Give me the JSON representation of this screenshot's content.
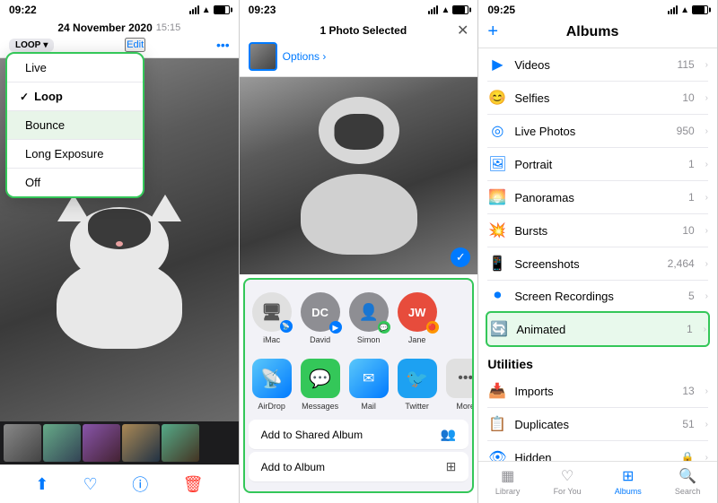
{
  "panel1": {
    "status_time": "09:22",
    "date": "24 November 2020",
    "date_sub": "15:15",
    "edit_label": "Edit",
    "loop_label": "LOOP",
    "dropdown": {
      "items": [
        {
          "label": "Live",
          "selected": false,
          "highlighted": false
        },
        {
          "label": "Loop",
          "selected": true,
          "highlighted": false
        },
        {
          "label": "Bounce",
          "selected": false,
          "highlighted": true
        },
        {
          "label": "Long Exposure",
          "selected": false,
          "highlighted": false
        },
        {
          "label": "Off",
          "selected": false,
          "highlighted": false
        }
      ]
    },
    "toolbar": {
      "share": "↑",
      "heart": "♡",
      "info": "ⓘ",
      "trash": "🗑"
    }
  },
  "panel2": {
    "status_time": "09:23",
    "photo_count": "1 Photo Selected",
    "options_label": "Options ›",
    "close_label": "✕",
    "share_contacts": [
      {
        "name": "iMac",
        "initials": "🖥",
        "badge": "📡",
        "badge_color": "blue"
      },
      {
        "name": "David",
        "initials": "DC",
        "badge": "📹",
        "badge_color": "blue"
      },
      {
        "name": "Simon",
        "initials": "👤",
        "badge": "💬",
        "badge_color": "green"
      },
      {
        "name": "Jane",
        "initials": "JW",
        "badge": "🔴",
        "badge_color": "orange"
      }
    ],
    "share_apps": [
      {
        "name": "AirDrop",
        "icon": "📡",
        "type": "airdrop"
      },
      {
        "name": "Messages",
        "icon": "💬",
        "type": "messages"
      },
      {
        "name": "Mail",
        "icon": "✉",
        "type": "mail"
      },
      {
        "name": "Twitter",
        "icon": "🐦",
        "type": "twitter"
      },
      {
        "name": "More",
        "icon": "…",
        "type": "more"
      }
    ],
    "actions": [
      {
        "label": "Add to Shared Album",
        "icon": "👥"
      },
      {
        "label": "Add to Album",
        "icon": "🖼"
      }
    ]
  },
  "panel3": {
    "status_time": "09:25",
    "title": "Albums",
    "add_icon": "+",
    "albums": [
      {
        "name": "Videos",
        "count": "115",
        "icon": "▶"
      },
      {
        "name": "Selfies",
        "count": "10",
        "icon": "😊"
      },
      {
        "name": "Live Photos",
        "count": "950",
        "icon": "◎"
      },
      {
        "name": "Portrait",
        "count": "1",
        "icon": "🖼"
      },
      {
        "name": "Panoramas",
        "count": "1",
        "icon": "🌅"
      },
      {
        "name": "Bursts",
        "count": "10",
        "icon": "💥"
      },
      {
        "name": "Screenshots",
        "count": "2,464",
        "icon": "📱"
      },
      {
        "name": "Screen Recordings",
        "count": "5",
        "icon": "⏺"
      },
      {
        "name": "Animated",
        "count": "1",
        "icon": "🔄",
        "highlighted": true
      }
    ],
    "utilities_header": "Utilities",
    "utilities": [
      {
        "name": "Imports",
        "count": "13",
        "icon": "📥"
      },
      {
        "name": "Duplicates",
        "count": "51",
        "icon": "📋"
      },
      {
        "name": "Hidden",
        "count": "🔒",
        "icon": "👁"
      }
    ],
    "tabs": [
      {
        "label": "Library",
        "icon": "▦",
        "active": false
      },
      {
        "label": "For You",
        "icon": "♡",
        "active": false
      },
      {
        "label": "Albums",
        "icon": "⊞",
        "active": true
      },
      {
        "label": "Search",
        "icon": "🔍",
        "active": false
      }
    ]
  }
}
